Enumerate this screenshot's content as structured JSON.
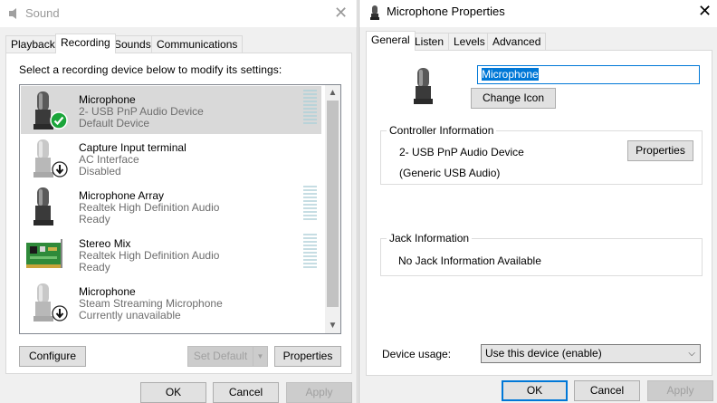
{
  "sound": {
    "title": "Sound",
    "tabs": [
      {
        "label": "Playback"
      },
      {
        "label": "Recording"
      },
      {
        "label": "Sounds"
      },
      {
        "label": "Communications"
      }
    ],
    "instruction": "Select a recording device below to modify its settings:",
    "devices": [
      {
        "name": "Microphone",
        "line2": "2- USB PnP Audio Device",
        "line3": "Default Device",
        "status_icon": "green-check-icon"
      },
      {
        "name": "Capture Input terminal",
        "line2": "AC Interface",
        "line3": "Disabled",
        "status_icon": "down-arrow-icon"
      },
      {
        "name": "Microphone Array",
        "line2": "Realtek High Definition Audio",
        "line3": "Ready"
      },
      {
        "name": "Stereo Mix",
        "line2": "Realtek High Definition Audio",
        "line3": "Ready"
      },
      {
        "name": "Microphone",
        "line2": "Steam Streaming Microphone",
        "line3": "Currently unavailable",
        "status_icon": "down-arrow-icon"
      }
    ],
    "buttons": {
      "configure": "Configure",
      "set_default": "Set Default",
      "properties": "Properties"
    },
    "footer": {
      "ok": "OK",
      "cancel": "Cancel",
      "apply": "Apply"
    }
  },
  "props": {
    "title": "Microphone Properties",
    "tabs": [
      {
        "label": "General"
      },
      {
        "label": "Listen"
      },
      {
        "label": "Levels"
      },
      {
        "label": "Advanced"
      }
    ],
    "name_value": "Microphone",
    "change_icon": "Change Icon",
    "controller": {
      "title": "Controller Information",
      "device": "2- USB PnP Audio Device",
      "driver": "(Generic USB Audio)",
      "properties": "Properties"
    },
    "jack": {
      "title": "Jack Information",
      "text": "No Jack Information Available"
    },
    "device_usage": {
      "label": "Device usage:",
      "value": "Use this device (enable)"
    },
    "footer": {
      "ok": "OK",
      "cancel": "Cancel",
      "apply": "Apply"
    }
  },
  "colors": {
    "accent": "#0078d7",
    "selected_row": "#d9d9d9",
    "status_green": "#1aa53a"
  }
}
